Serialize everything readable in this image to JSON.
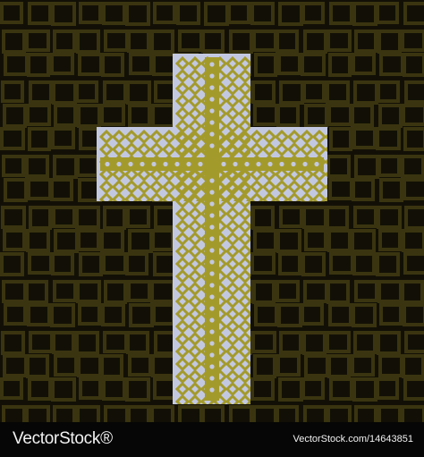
{
  "image": {
    "subject": "cross-icon",
    "colors": {
      "background": "#121006",
      "grid_line": "#3a3410",
      "cross_fill": "#c3c8e1",
      "pattern_gold": "#a39a2c",
      "footer": "#060606",
      "footer_text": "#f2f2f2"
    }
  },
  "footer": {
    "brand": "VectorStock®",
    "image_id": "VectorStock.com/14643851"
  }
}
